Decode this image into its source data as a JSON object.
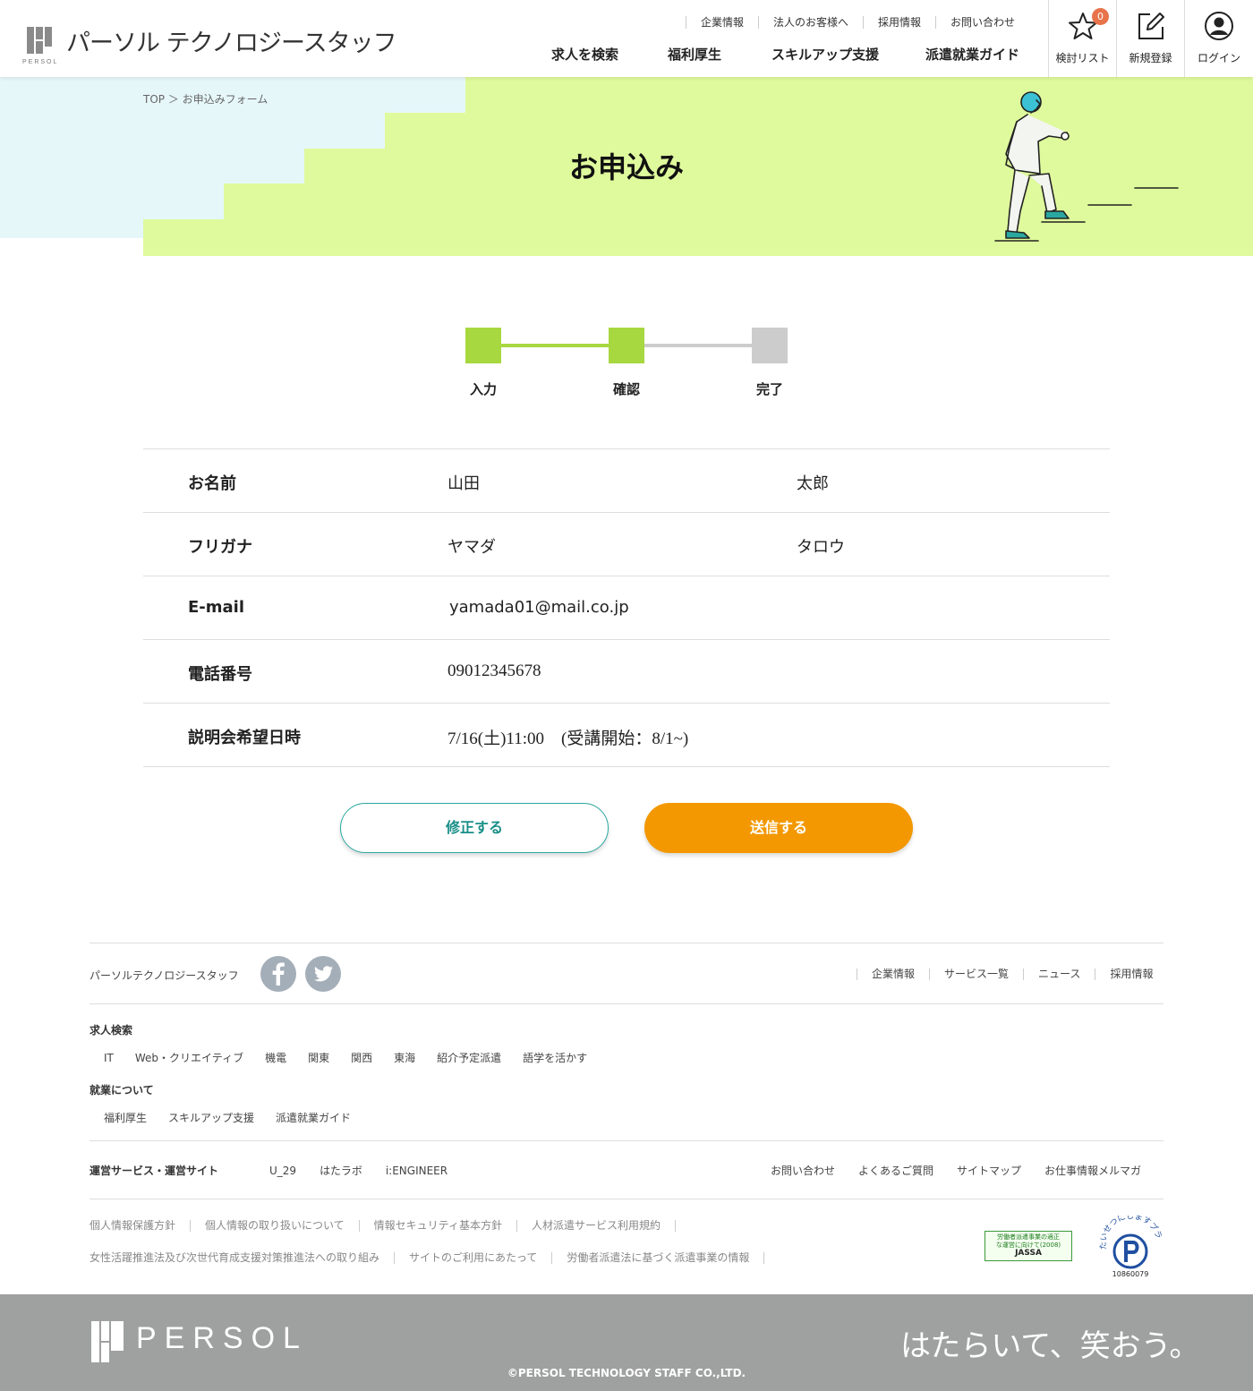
{
  "header": {
    "brand": "パーソル テクノロジースタッフ",
    "logo_small": "PERSOL",
    "top_links": [
      "企業情報",
      "法人のお客様へ",
      "採用情報",
      "お問い合わせ"
    ],
    "main_nav": [
      "求人を検索",
      "福利厚生",
      "スキルアップ支援",
      "派遣就業ガイド"
    ],
    "watchlist_label": "検討リスト",
    "watchlist_count": "0",
    "register_label": "新規登録",
    "login_label": "ログイン"
  },
  "breadcrumb": "TOP ＞ お申込みフォーム",
  "page_title": "お申込み",
  "steps": [
    "入力",
    "確認",
    "完了"
  ],
  "form": {
    "rows": [
      {
        "label": "お名前",
        "v1": "山田",
        "v2": "太郎"
      },
      {
        "label": "フリガナ",
        "v1": "ヤマダ",
        "v2": "タロウ"
      },
      {
        "label": "E-mail",
        "v1": "yamada01@mail.co.jp"
      },
      {
        "label": "電話番号",
        "v1": "09012345678"
      },
      {
        "label": "説明会希望日時",
        "v1": "7/16(土)11:00　(受講開始：8/1~)"
      }
    ]
  },
  "buttons": {
    "edit": "修正する",
    "send": "送信する"
  },
  "footer": {
    "company": "パーソルテクノロジースタッフ",
    "top_links": [
      "企業情報",
      "サービス一覧",
      "ニュース",
      "採用情報"
    ],
    "job_search_title": "求人検索",
    "job_search_links": [
      "IT",
      "Web・クリエイティブ",
      "機電",
      "関東",
      "関西",
      "東海",
      "紹介予定派遣",
      "語学を活かす"
    ],
    "employment_title": "就業について",
    "employment_links": [
      "福利厚生",
      "スキルアップ支援",
      "派遣就業ガイド"
    ],
    "services_title": "運営サービス・運営サイト",
    "services_links": [
      "U_29",
      "はたラボ",
      "i:ENGINEER"
    ],
    "support_links": [
      "お問い合わせ",
      "よくあるご質問",
      "サイトマップ",
      "お仕事情報メルマガ"
    ],
    "legal_row1": [
      "個人情報保護方針",
      "個人情報の取り扱いについて",
      "情報セキュリティ基本方針",
      "人材派遣サービス利用規約"
    ],
    "legal_row2": [
      "女性活躍推進法及び次世代育成支援対策推進法への取り組み",
      "サイトのご利用にあたって",
      "労働者派遣法に基づく派遣事業の情報"
    ],
    "jassa_line1": "労働者派遣事業の適正",
    "jassa_line2": "な運営に向けて(2008)",
    "jassa_name": "JASSA",
    "privacy_arc": "たいせつにしますプライバシー",
    "privacy_no": "10860079",
    "persol": "PERSOL",
    "slogan": "はたらいて、笑おう。",
    "copyright": "©PERSOL TECHNOLOGY STAFF CO.,LTD."
  },
  "colors": {
    "accent_green": "#a8d840",
    "hero_green": "#dffa9c",
    "hero_blue": "#e6f7fa",
    "send_orange": "#f39800",
    "edit_teal": "#1a8f88",
    "footer_gray": "#9fa0a0"
  }
}
